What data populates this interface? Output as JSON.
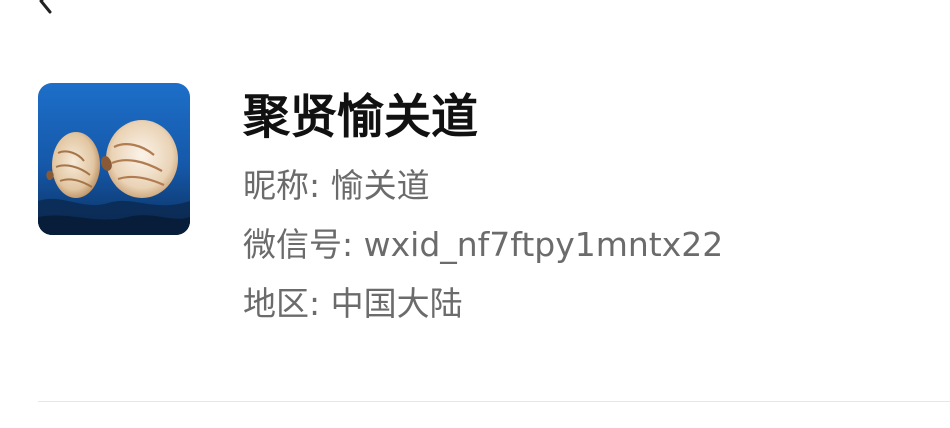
{
  "header": {
    "back_icon": "chevron-left-icon"
  },
  "profile": {
    "avatar_icon": "nautilus-photo",
    "display_name": "聚贤愉关道",
    "nickname_label": "昵称:",
    "nickname_value": "愉关道",
    "wxid_label": "微信号:",
    "wxid_value": "wxid_nf7ftpy1mntx22",
    "region_label": "地区:",
    "region_value": "中国大陆"
  },
  "colors": {
    "name_text": "#111111",
    "info_text": "#6b6b6b",
    "divider": "#e6e6e6",
    "background": "#ffffff"
  }
}
